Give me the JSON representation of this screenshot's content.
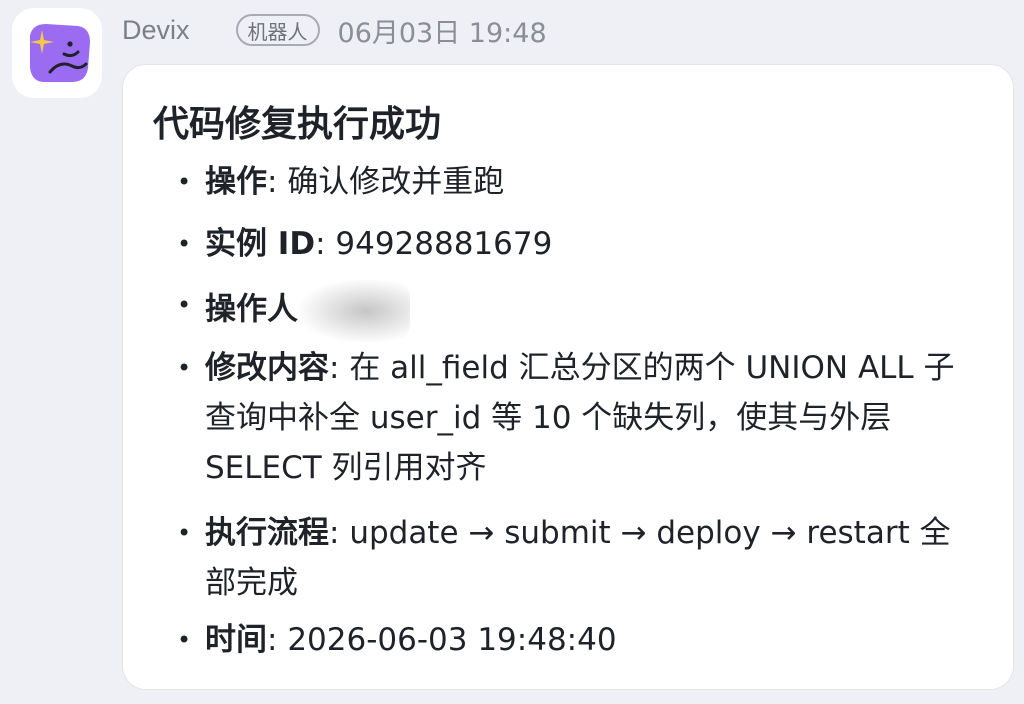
{
  "header": {
    "sender": "Devix",
    "bot_badge": "机器人",
    "timestamp": "06月03日 19:48"
  },
  "avatar": {
    "icon": "sparkle-face-icon",
    "bg_color": "#9b6bf2",
    "accent_color": "#f5c84b"
  },
  "message": {
    "title": "代码修复执行成功",
    "items": [
      {
        "label": "操作",
        "sep": ": ",
        "value": "确认修改并重跑"
      },
      {
        "label": "实例 ID",
        "sep": ": ",
        "value": "94928881679"
      },
      {
        "label": "操作人",
        "sep": "",
        "value": ""
      },
      {
        "label": "修改内容",
        "sep": ": ",
        "value": "在 all_field 汇总分区的两个 UNION ALL 子查询中补全 user_id 等 10 个缺失列，使其与外层 SELECT 列引用对齐"
      },
      {
        "label": "执行流程",
        "sep": ": ",
        "value": "update → submit → deploy → restart 全部完成"
      },
      {
        "label": "时间",
        "sep": ": ",
        "value": "2026-06-03 19:48:40"
      }
    ]
  }
}
